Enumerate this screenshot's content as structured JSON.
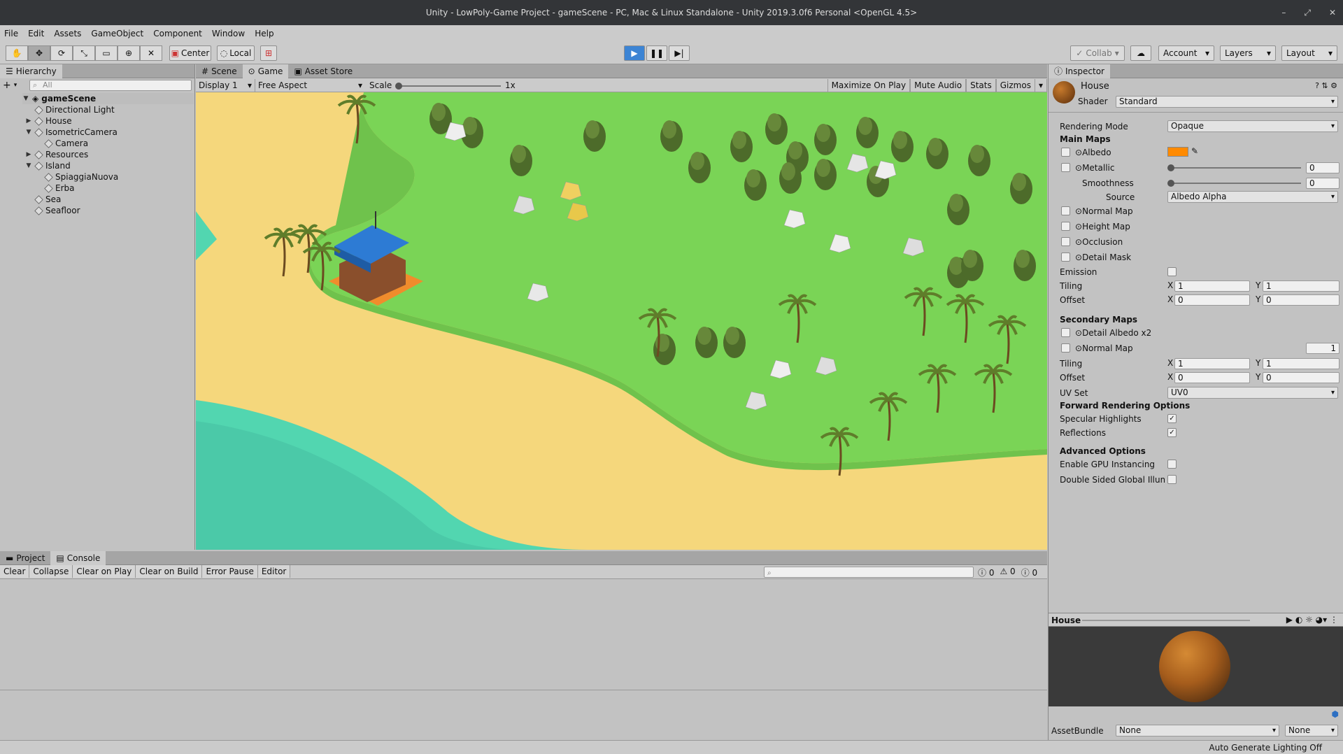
{
  "window": {
    "title": "Unity - LowPoly-Game Project - gameScene - PC, Mac & Linux Standalone - Unity 2019.3.0f6 Personal <OpenGL 4.5>"
  },
  "menu": [
    "File",
    "Edit",
    "Assets",
    "GameObject",
    "Component",
    "Window",
    "Help"
  ],
  "toolbar": {
    "center": "Center",
    "local": "Local",
    "collab": "Collab",
    "account": "Account",
    "layers": "Layers",
    "layout": "Layout"
  },
  "hierarchy": {
    "tab": "Hierarchy",
    "search_placeholder": "All",
    "scene": "gameScene",
    "items": [
      {
        "label": "Directional Light",
        "depth": 1,
        "arrow": ""
      },
      {
        "label": "House",
        "depth": 1,
        "arrow": "▶"
      },
      {
        "label": "IsometricCamera",
        "depth": 1,
        "arrow": "▼"
      },
      {
        "label": "Camera",
        "depth": 2,
        "arrow": ""
      },
      {
        "label": "Resources",
        "depth": 1,
        "arrow": "▶"
      },
      {
        "label": "Island",
        "depth": 1,
        "arrow": "▼"
      },
      {
        "label": "SpiaggiaNuova",
        "depth": 2,
        "arrow": ""
      },
      {
        "label": "Erba",
        "depth": 2,
        "arrow": ""
      },
      {
        "label": "Sea",
        "depth": 1,
        "arrow": ""
      },
      {
        "label": "Seafloor",
        "depth": 1,
        "arrow": ""
      }
    ]
  },
  "game": {
    "tabs": [
      "Scene",
      "Game",
      "Asset Store"
    ],
    "display": "Display 1",
    "aspect": "Free Aspect",
    "scale_label": "Scale",
    "scale_value": "1x",
    "toggles": [
      "Maximize On Play",
      "Mute Audio",
      "Stats",
      "Gizmos"
    ]
  },
  "console": {
    "tabs": [
      "Project",
      "Console"
    ],
    "buttons": [
      "Clear",
      "Collapse",
      "Clear on Play",
      "Clear on Build",
      "Error Pause",
      "Editor"
    ],
    "counts": [
      "0",
      "0",
      "0"
    ]
  },
  "inspector": {
    "tab": "Inspector",
    "object": "House",
    "shader_label": "Shader",
    "shader": "Standard",
    "rendering_mode_label": "Rendering Mode",
    "rendering_mode": "Opaque",
    "main_maps": "Main Maps",
    "albedo": "Albedo",
    "albedo_color": "#ff8a00",
    "metallic": "Metallic",
    "metallic_value": "0",
    "smoothness": "Smoothness",
    "smoothness_value": "0",
    "source_label": "Source",
    "source": "Albedo Alpha",
    "normal_map": "Normal Map",
    "height_map": "Height Map",
    "occlusion": "Occlusion",
    "detail_mask": "Detail Mask",
    "emission": "Emission",
    "tiling": "Tiling",
    "offset": "Offset",
    "x": "X",
    "y": "Y",
    "tiling_x": "1",
    "tiling_y": "1",
    "offset_x": "0",
    "offset_y": "0",
    "secondary_maps": "Secondary Maps",
    "detail_albedo": "Detail Albedo x2",
    "normal_map2": "Normal Map",
    "normal_map2_value": "1",
    "tiling2_x": "1",
    "tiling2_y": "1",
    "offset2_x": "0",
    "offset2_y": "0",
    "uv_set_label": "UV Set",
    "uv_set": "UV0",
    "forward_options": "Forward Rendering Options",
    "specular": "Specular Highlights",
    "reflections": "Reflections",
    "advanced": "Advanced Options",
    "gpu_instancing": "Enable GPU Instancing",
    "double_sided": "Double Sided Global Illumin",
    "preview_title": "House",
    "assetbundle_label": "AssetBundle",
    "assetbundle": "None",
    "assetbundle_variant": "None"
  },
  "status": {
    "right": "Auto Generate Lighting Off"
  }
}
